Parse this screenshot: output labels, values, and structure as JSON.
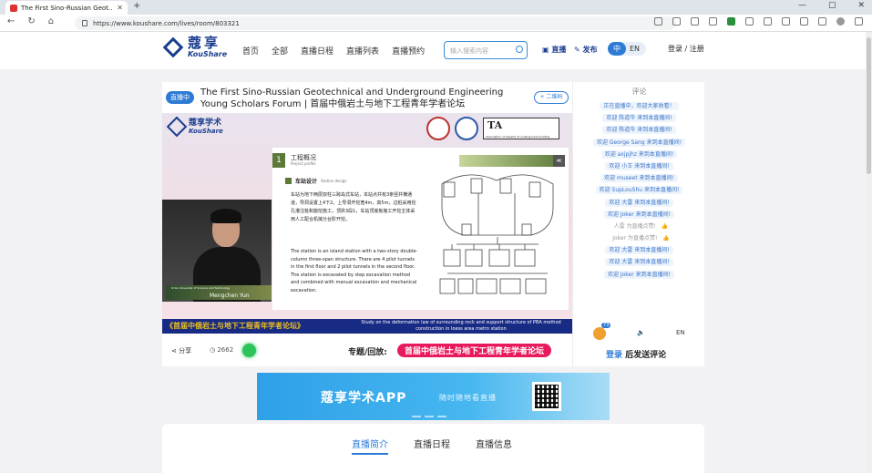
{
  "browser": {
    "tab_title": "The First Sino-Russian Geot…",
    "url": "https://www.koushare.com/lives/room/803321",
    "new_tab": "+",
    "tab_close": "✕",
    "win_minimize": "—",
    "win_maximize": "▢",
    "win_close": "✕"
  },
  "site": {
    "logo_cn": "蔻享",
    "logo_en": "KouShare",
    "nav": [
      "首页",
      "全部",
      "直播日程",
      "直播列表",
      "直播预约"
    ],
    "search_placeholder": "输入搜索内容",
    "live_btn": "直播",
    "publish_btn": "发布",
    "lang_zh": "中",
    "lang_en": "EN",
    "login": "登录 / 注册"
  },
  "live": {
    "badge": "直播中",
    "title": "The First Sino-Russian Geotechnical and Underground Engineering Young Scholars Forum | 首届中俄岩土与地下工程青年学者论坛",
    "follow_btn": "+ 二维码",
    "video": {
      "logo_cn": "蔻享学术",
      "logo_en": "KouShare",
      "ta_text": "TA",
      "ta_sub": "Association of experts of underground building",
      "slide_num": "1",
      "slide_heading": "工程概况",
      "slide_heading_en": "Project profile",
      "slide_share": "≪",
      "slide_sub": "车站设计",
      "slide_sub_en": "Station design",
      "slide_cn": "车站为地下两层双柱三跨岛式车站，本站点共有3条竖井横通道，导洞设置上4下2。上导洞开挖宽4m，高5m，边桩采用挖孔灌注桩和旋挖施工，顶拱3段1，车站顶底板施工开挖主体采用人工配合机械分台阶开挖。",
      "slide_en": "The station is an island station with a two-story double-column three-span structure. There are 4 pilot tunnels in the first floor and 2 pilot tunnels in the second floor. The station is excavated by step excavation method and combined with manual excavation and mechanical excavation.",
      "presenter_affil": "Xi'an University of Science and Technology",
      "presenter_name": "Mengchen Yun",
      "banner_cn": "《首届中俄岩土与地下工程青年学者论坛》",
      "banner_en": "Study on the deformation law of surrounding rock and support structure of PBA method construction in loess area metro station"
    },
    "share_label": "分享",
    "views": "2662",
    "topic_label": "专题/回放:",
    "topic_value": "首届中俄岩土与地下工程青年学者论坛"
  },
  "comments": {
    "title": "评论",
    "items": [
      {
        "text": "正在直播中，欢迎大家收看！",
        "gray": false
      },
      {
        "text": "欢迎 陈道华 来到本直播间!",
        "gray": false
      },
      {
        "text": "欢迎 陈道华 来到本直播间!",
        "gray": false
      },
      {
        "text": "欢迎 George Sang 来到本直播间!",
        "gray": false
      },
      {
        "text": "欢迎 axjpjhz 来到本直播间!",
        "gray": false
      },
      {
        "text": "欢迎 小王 来到本直播间!",
        "gray": false
      },
      {
        "text": "欢迎 museet 来到本直播间!",
        "gray": false
      },
      {
        "text": "欢迎 SupLouShu 来到本直播间!",
        "gray": false
      },
      {
        "text": "欢迎 大雷 来到本直播间!",
        "gray": false
      },
      {
        "text": "欢迎 Joker 来到本直播间!",
        "gray": false
      },
      {
        "text": "人雷 为直播点赞!",
        "gray": true
      },
      {
        "text": "Joker 为直播点赞!",
        "gray": true
      },
      {
        "text": "欢迎 大雷 来到本直播间!",
        "gray": false
      },
      {
        "text": "欢迎 大雷 来到本直播间!",
        "gray": false
      },
      {
        "text": "欢迎 Joker 来到本直播间!",
        "gray": false
      }
    ],
    "like_count": "73",
    "volume_icon": "🔈",
    "lang_btn": "EN",
    "login_link": "登录",
    "login_rest": "后发送评论",
    "thumb": "👍"
  },
  "app_ad": {
    "title": "蔻享学术APP",
    "slogan": "随时随地看直播"
  },
  "info_tabs": [
    "直播简介",
    "直播日程",
    "直播信息"
  ],
  "colors": {
    "brand": "#1b3d8f",
    "accent": "#2e7bd6",
    "topic_pink": "#e8195c",
    "slide_green": "#5b7a3a"
  }
}
